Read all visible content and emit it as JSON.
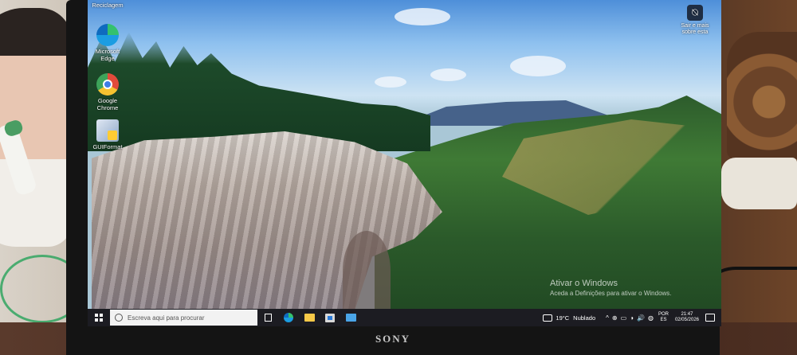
{
  "desktop": {
    "icons": [
      {
        "label": "Reciclagem",
        "icon": "recycle-bin-icon"
      },
      {
        "label": "Microsoft Edge",
        "icon": "edge-icon"
      },
      {
        "label": "Google Chrome",
        "icon": "chrome-icon"
      },
      {
        "label": "GUIFormat",
        "icon": "guiformat-icon"
      }
    ],
    "signout": {
      "label": "Sair e mais sobre esta",
      "icon": "sign-out-icon"
    },
    "activate": {
      "title": "Ativar o Windows",
      "subtitle": "Aceda a Definições para ativar o Windows."
    }
  },
  "taskbar": {
    "search_placeholder": "Escreva aqui para procurar",
    "pinned": [
      {
        "name": "task-view",
        "icon": "task-view-icon"
      },
      {
        "name": "edge",
        "icon": "edge-icon"
      },
      {
        "name": "file-explorer",
        "icon": "folder-icon"
      },
      {
        "name": "store",
        "icon": "store-icon"
      },
      {
        "name": "mail",
        "icon": "mail-icon"
      }
    ],
    "weather": {
      "temp": "19°C",
      "condition": "Nublado"
    },
    "tray_icons": [
      "^",
      "⊕",
      "▭",
      "◑",
      "🔊",
      "◍"
    ],
    "lang": {
      "line1": "POR",
      "line2": "ES"
    },
    "clock": {
      "time": "21:47",
      "date": "02/05/2026"
    }
  },
  "brand": {
    "name": "SONY"
  },
  "colors": {
    "taskbar": "#1c1c22",
    "search_bg": "#f2f2f2",
    "bezel": "#141414"
  }
}
